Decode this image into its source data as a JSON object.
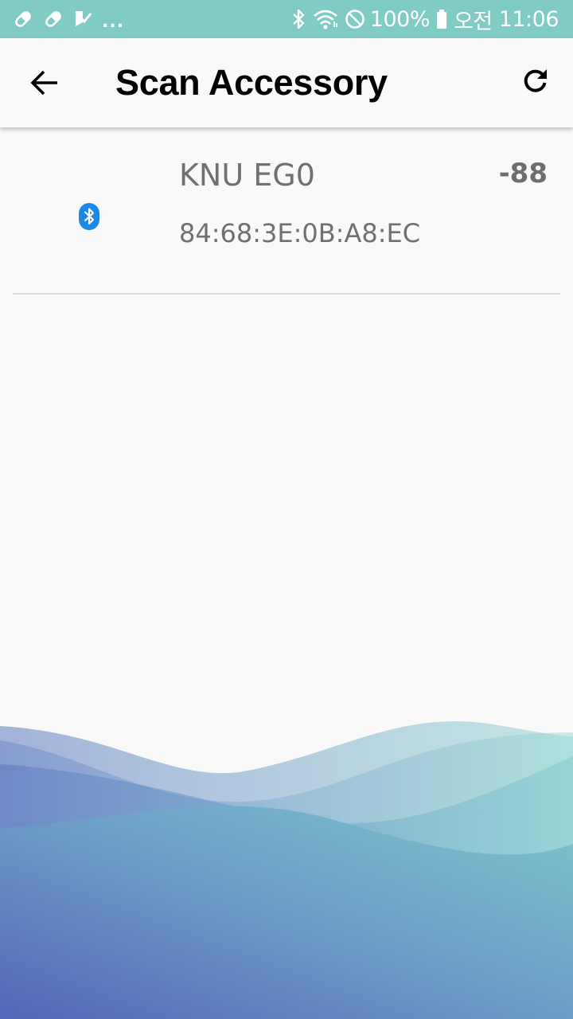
{
  "status_bar": {
    "left_icons": [
      "pill-icon",
      "pill-icon",
      "tasks-icon",
      "more-notifications-icon"
    ],
    "more_text": "...",
    "right_icons": [
      "bluetooth-icon",
      "wifi-icon",
      "do-not-disturb-icon",
      "battery-icon"
    ],
    "battery": "100%",
    "ampm": "오전",
    "time": "11:06",
    "background_color": "#80cbc4"
  },
  "app_bar": {
    "title": "Scan Accessory",
    "back_icon": "arrow-left-icon",
    "refresh_icon": "refresh-icon"
  },
  "devices": [
    {
      "icon": "bluetooth-icon",
      "name": "KNU EG0",
      "mac": "84:68:3E:0B:A8:EC",
      "rssi": "-88"
    }
  ],
  "colors": {
    "bluetooth_accent": "#1e88e5",
    "wave_left": "#5368ba",
    "wave_right": "#7fc6cc"
  }
}
